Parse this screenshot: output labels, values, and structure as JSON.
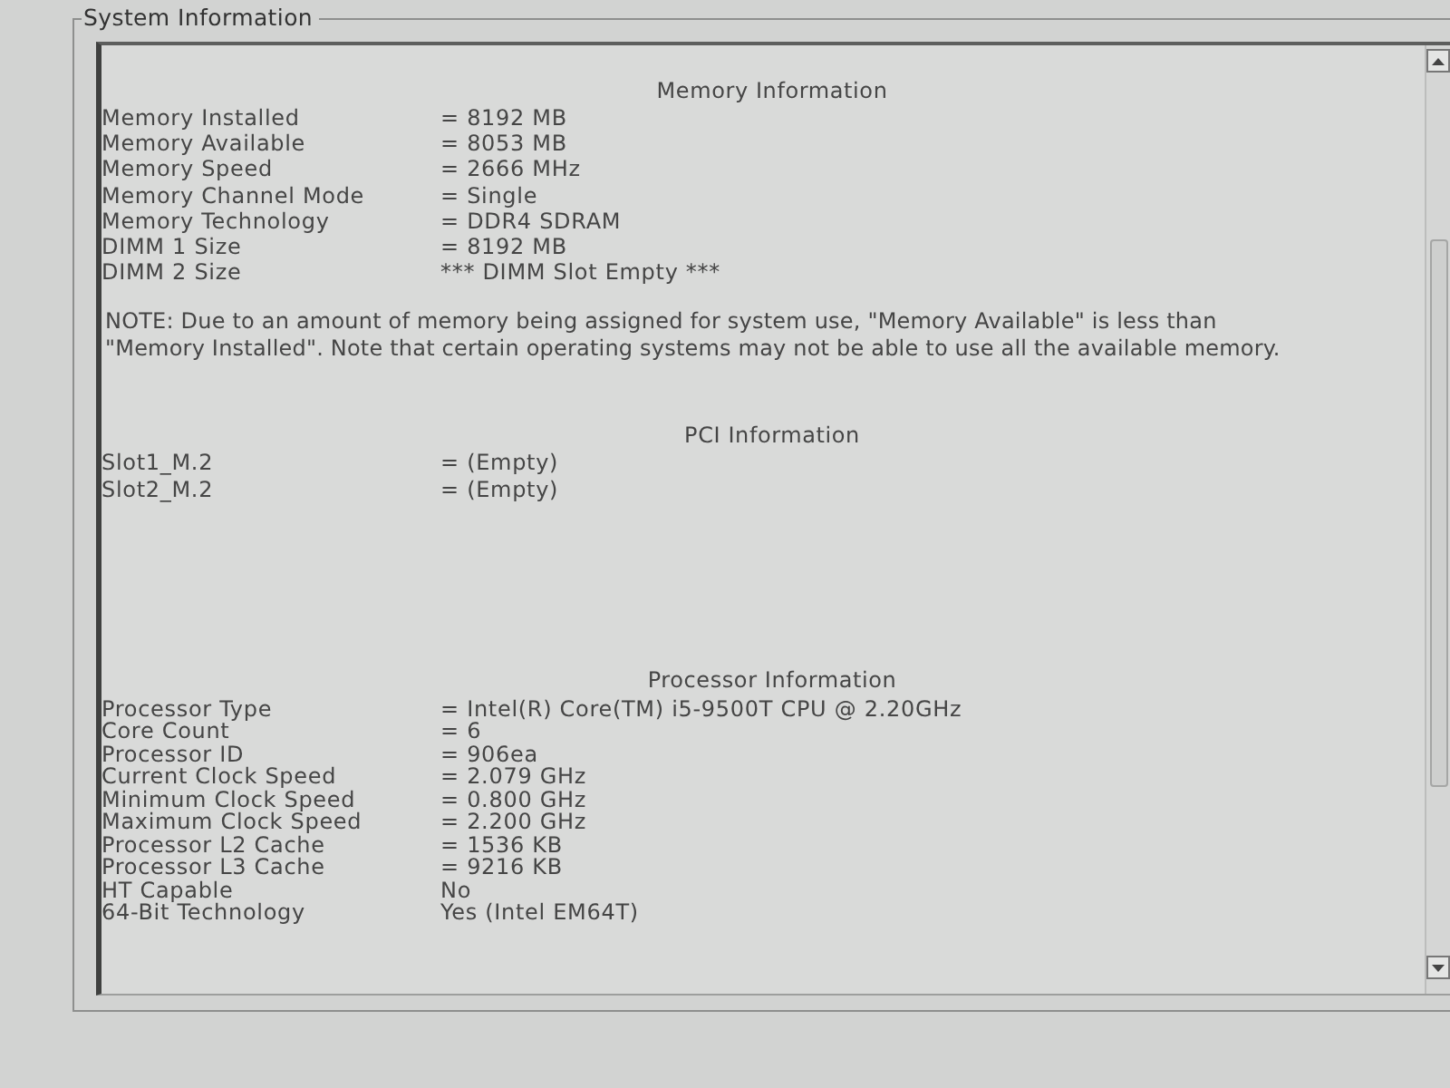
{
  "group_title": "System Information",
  "sections": [
    {
      "heading": "Memory Information",
      "rows": [
        {
          "label": "Memory Installed",
          "value": "= 8192 MB"
        },
        {
          "label": "Memory Available",
          "value": "= 8053 MB"
        },
        {
          "label": "Memory Speed",
          "value": "= 2666 MHz"
        },
        {
          "label": "Memory Channel Mode",
          "value": "= Single"
        },
        {
          "label": "Memory Technology",
          "value": "= DDR4 SDRAM"
        },
        {
          "label": "DIMM 1 Size",
          "value": "= 8192 MB"
        },
        {
          "label": "DIMM 2 Size",
          "value": "*** DIMM Slot Empty ***"
        }
      ],
      "note": "NOTE: Due to an amount of memory being assigned for system use, \"Memory Available\" is less than \"Memory Installed\". Note that certain operating systems may not be able to use all the available memory."
    },
    {
      "heading": "PCI Information",
      "rows": [
        {
          "label": "Slot1_M.2",
          "value": "= (Empty)"
        },
        {
          "label": "Slot2_M.2",
          "value": "= (Empty)"
        }
      ]
    },
    {
      "heading": "Processor Information",
      "rows": [
        {
          "label": "Processor Type",
          "value": "= Intel(R) Core(TM) i5-9500T CPU @ 2.20GHz"
        },
        {
          "label": "Core Count",
          "value": "= 6"
        },
        {
          "label": "Processor ID",
          "value": "= 906ea"
        },
        {
          "label": "Current Clock Speed",
          "value": "= 2.079 GHz"
        },
        {
          "label": "Minimum Clock Speed",
          "value": "= 0.800 GHz"
        },
        {
          "label": "Maximum Clock Speed",
          "value": "= 2.200 GHz"
        },
        {
          "label": "Processor L2 Cache",
          "value": "= 1536 KB"
        },
        {
          "label": "Processor L3 Cache",
          "value": "= 9216 KB"
        },
        {
          "label": "HT Capable",
          "value": "No"
        },
        {
          "label": "64-Bit Technology",
          "value": "Yes (Intel EM64T)"
        }
      ]
    }
  ]
}
